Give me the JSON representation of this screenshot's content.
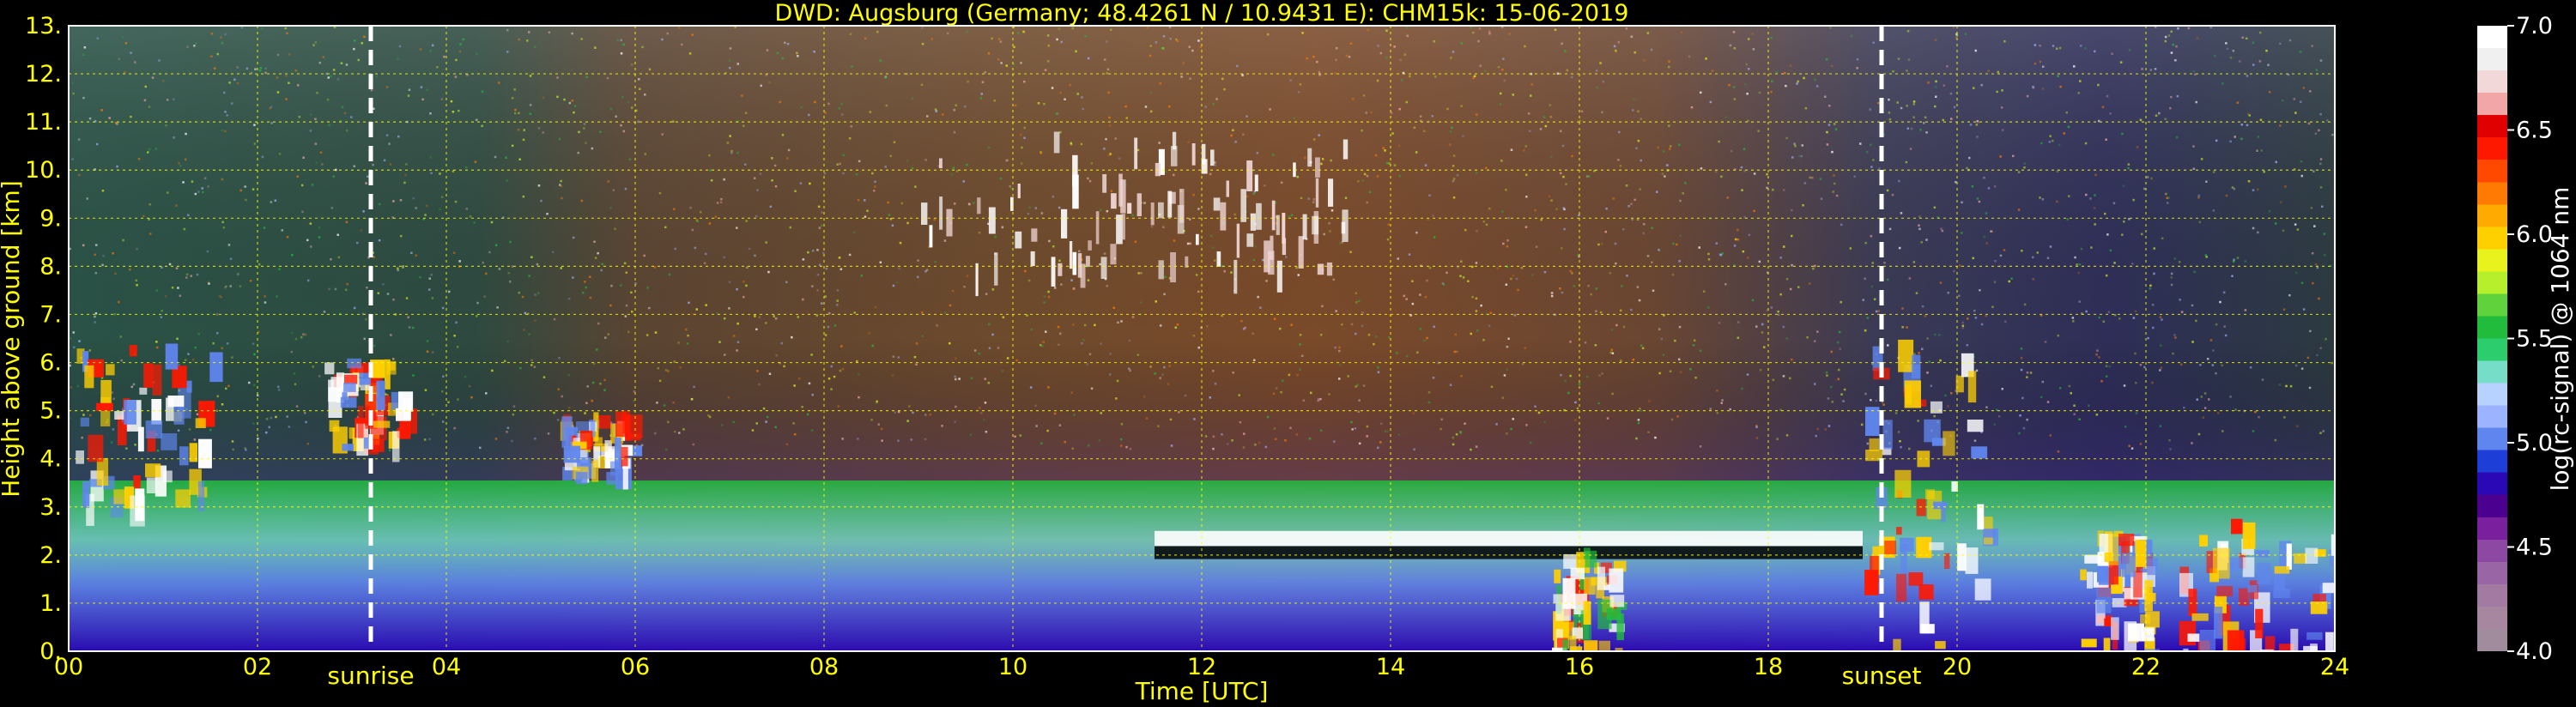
{
  "chart_data": {
    "type": "heatmap",
    "title": "DWD: Augsburg (Germany; 48.4261 N / 10.9431 E):    CHM15k: 15-06-2019",
    "xlabel": "Time [UTC]",
    "ylabel": "Height above ground [km]",
    "x_ticks": [
      "00",
      "02",
      "04",
      "06",
      "08",
      "10",
      "12",
      "14",
      "16",
      "18",
      "20",
      "22",
      "24"
    ],
    "y_ticks": [
      "0.",
      "1.",
      "2.",
      "3.",
      "4.",
      "5.",
      "6.",
      "7.",
      "8.",
      "9.",
      "10.",
      "11.",
      "12.",
      "13."
    ],
    "xlim": [
      0,
      24
    ],
    "ylim": [
      0,
      13
    ],
    "grid": true,
    "annotations": [
      {
        "label": "sunrise",
        "x": 3.2
      },
      {
        "label": "sunset",
        "x": 19.2
      }
    ],
    "colorbar": {
      "label": "log(rc-signal) @ 1064 nm",
      "ticks": [
        "4.0",
        "4.5",
        "5.0",
        "5.5",
        "6.0",
        "6.5",
        "7.0"
      ],
      "range": [
        4.0,
        7.0
      ],
      "colors": [
        "#a08c9c",
        "#a6879f",
        "#a27aa2",
        "#9965a5",
        "#8d48a4",
        "#7a209c",
        "#4b0090",
        "#2a08b6",
        "#1d3fd8",
        "#5f86ee",
        "#9cb4ff",
        "#b7d2ff",
        "#75ddc8",
        "#2bcd6c",
        "#22bc3c",
        "#5fd23c",
        "#b6f02c",
        "#e8f21c",
        "#ffd000",
        "#ffaa00",
        "#ff7a00",
        "#ff4800",
        "#ff1800",
        "#e00000",
        "#f2a6a6",
        "#f2d8d8",
        "#f0f0f0",
        "#ffffff"
      ]
    },
    "features": [
      {
        "type": "cloud",
        "x": [
          0.0,
          1.5
        ],
        "y": [
          3.2,
          6.4
        ]
      },
      {
        "type": "cloud",
        "x": [
          2.7,
          3.6
        ],
        "y": [
          4.2,
          6.1
        ]
      },
      {
        "type": "cloud",
        "x": [
          5.2,
          5.9
        ],
        "y": [
          3.7,
          5.0
        ]
      },
      {
        "type": "cirrus",
        "x": [
          9.0,
          13.5
        ],
        "y": [
          8.0,
          10.8
        ]
      },
      {
        "type": "cloud_top_layer",
        "x": [
          11.5,
          19.0
        ],
        "y": [
          1.6,
          2.5
        ]
      },
      {
        "type": "rain",
        "x": [
          15.7,
          16.4
        ],
        "y": [
          0.0,
          2.2
        ]
      },
      {
        "type": "cloud",
        "x": [
          19.0,
          20.3
        ],
        "y": [
          0.0,
          7.2
        ]
      },
      {
        "type": "cloud",
        "x": [
          21.3,
          22.0
        ],
        "y": [
          0.0,
          2.6
        ]
      },
      {
        "type": "cloud",
        "x": [
          22.3,
          24.0
        ],
        "y": [
          0.0,
          2.8
        ]
      }
    ]
  }
}
